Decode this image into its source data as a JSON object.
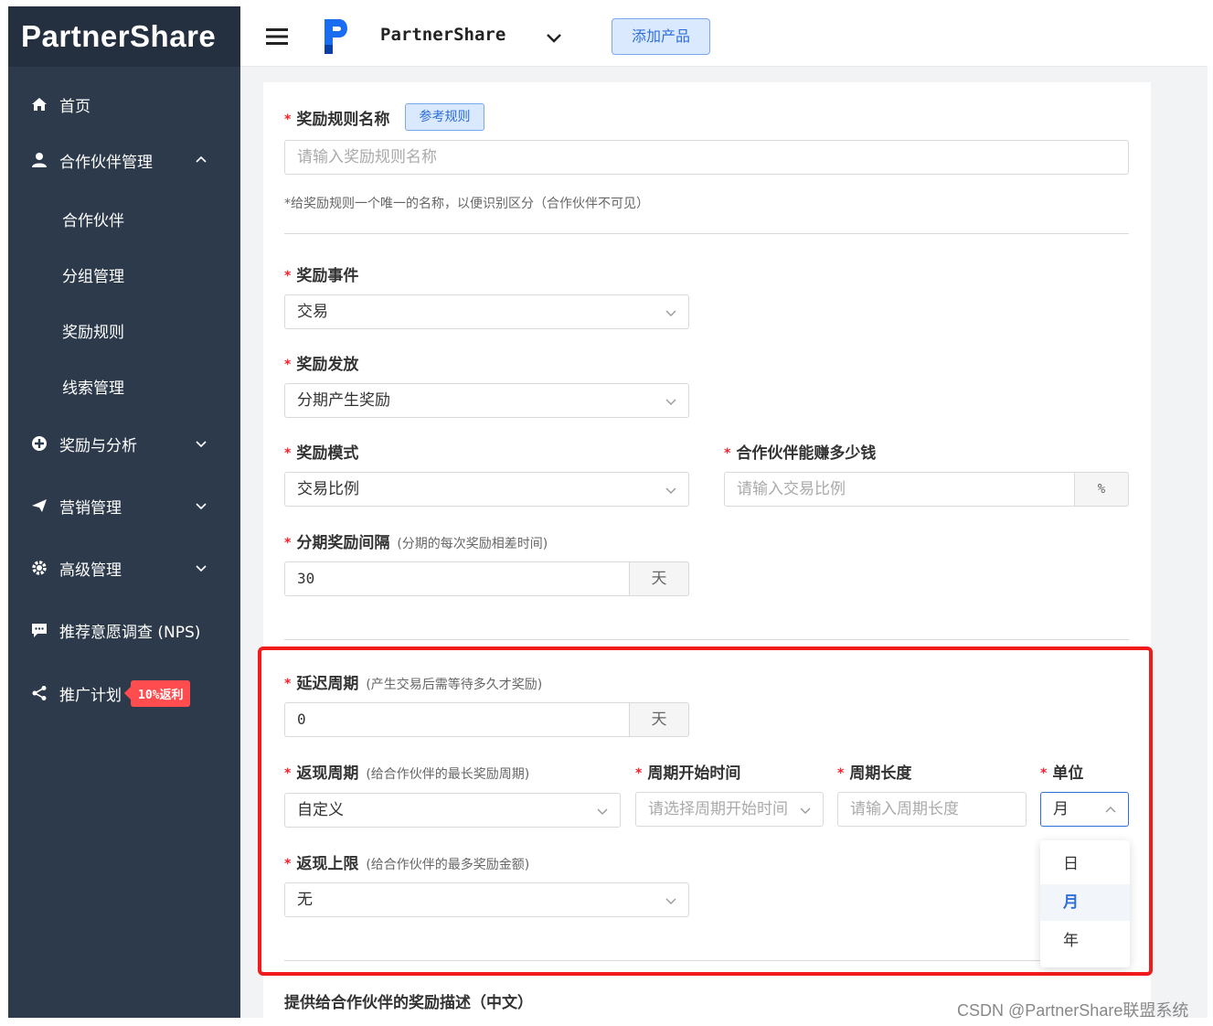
{
  "sidebar": {
    "brand": "PartnerShare",
    "items": [
      {
        "label": "首页"
      },
      {
        "label": "合作伙伴管理"
      },
      {
        "label": "奖励与分析"
      },
      {
        "label": "营销管理"
      },
      {
        "label": "高级管理"
      },
      {
        "label": "推荐意愿调查 (NPS)"
      },
      {
        "label": "推广计划",
        "badge": "10%返利"
      }
    ],
    "subitems": [
      {
        "label": "合作伙伴"
      },
      {
        "label": "分组管理"
      },
      {
        "label": "奖励规则"
      },
      {
        "label": "线索管理"
      }
    ]
  },
  "topbar": {
    "brand_name": "PartnerShare",
    "add_product": "添加产品"
  },
  "form": {
    "rule_name": {
      "label": "奖励规则名称",
      "ref_button": "参考规则",
      "placeholder": "请输入奖励规则名称",
      "note": "*给奖励规则一个唯一的名称，以便识别区分（合作伙伴不可见）"
    },
    "event": {
      "label": "奖励事件",
      "value": "交易"
    },
    "issuance": {
      "label": "奖励发放",
      "value": "分期产生奖励"
    },
    "mode": {
      "label": "奖励模式",
      "value": "交易比例"
    },
    "earn": {
      "label": "合作伙伴能赚多少钱",
      "placeholder": "请输入交易比例",
      "addon": "%"
    },
    "interval": {
      "label": "分期奖励间隔",
      "hint": "(分期的每次奖励相差时间)",
      "value": "30",
      "addon": "天"
    },
    "delay": {
      "label": "延迟周期",
      "hint": "(产生交易后需等待多久才奖励)",
      "value": "0",
      "addon": "天"
    },
    "cashback_period": {
      "label": "返现周期",
      "hint": "(给合作伙伴的最长奖励周期)",
      "value": "自定义"
    },
    "period_start": {
      "label": "周期开始时间",
      "placeholder": "请选择周期开始时间"
    },
    "period_length": {
      "label": "周期长度",
      "placeholder": "请输入周期长度"
    },
    "unit": {
      "label": "单位",
      "value": "月",
      "options": [
        "日",
        "月",
        "年"
      ],
      "selected": "月"
    },
    "cap": {
      "label": "返现上限",
      "hint": "(给合作伙伴的最多奖励金额)",
      "value": "无"
    },
    "description_label": "提供给合作伙伴的奖励描述（中文）"
  },
  "colors": {
    "sidebar": "#2d3a4b",
    "accent": "#2f6fd8",
    "required": "#f5222d",
    "highlight": "#f21b1b"
  },
  "watermark": "CSDN @PartnerShare联盟系统"
}
